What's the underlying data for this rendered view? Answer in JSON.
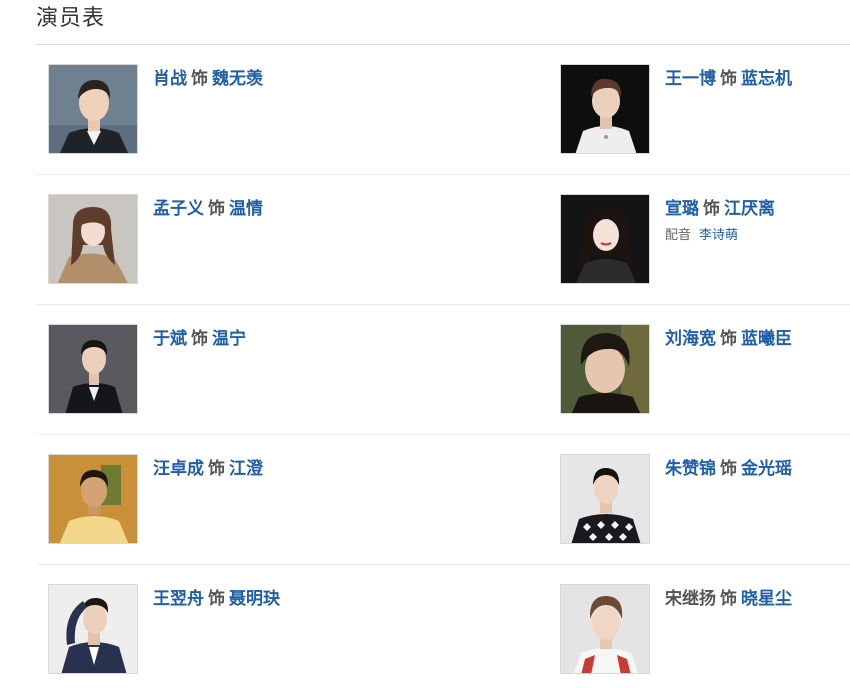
{
  "section": {
    "title": "演员表"
  },
  "separator": "饰",
  "cast": [
    {
      "left": {
        "actor": "肖战",
        "role": "魏无羡",
        "photo": "portrait-dark-suit"
      },
      "right": {
        "actor": "王一博",
        "role": "蓝忘机",
        "photo": "portrait-white-shirt-dark-bg"
      }
    },
    {
      "left": {
        "actor": "孟子义",
        "role": "温情",
        "photo": "portrait-woman-long-hair"
      },
      "right": {
        "actor": "宣璐",
        "role": "江厌离",
        "photo": "portrait-woman-dark-bg",
        "voice_label": "配音",
        "voice_actor": "李诗萌"
      }
    },
    {
      "left": {
        "actor": "于斌",
        "role": "温宁",
        "photo": "portrait-black-suit-grey-bg"
      },
      "right": {
        "actor": "刘海宽",
        "role": "蓝曦臣",
        "photo": "portrait-closeup-green-bg"
      }
    },
    {
      "left": {
        "actor": "汪卓成",
        "role": "江澄",
        "photo": "portrait-yellow-sweater"
      },
      "right": {
        "actor": "朱赞锦",
        "role": "金光瑶",
        "photo": "portrait-patterned-sweater"
      }
    },
    {
      "left": {
        "actor": "王翌舟",
        "role": "聂明玦",
        "photo": "portrait-navy-jacket"
      },
      "right": {
        "actor": "宋继扬",
        "role": "晓星尘",
        "photo": "portrait-red-white-collar",
        "actor_linked": false
      }
    }
  ]
}
